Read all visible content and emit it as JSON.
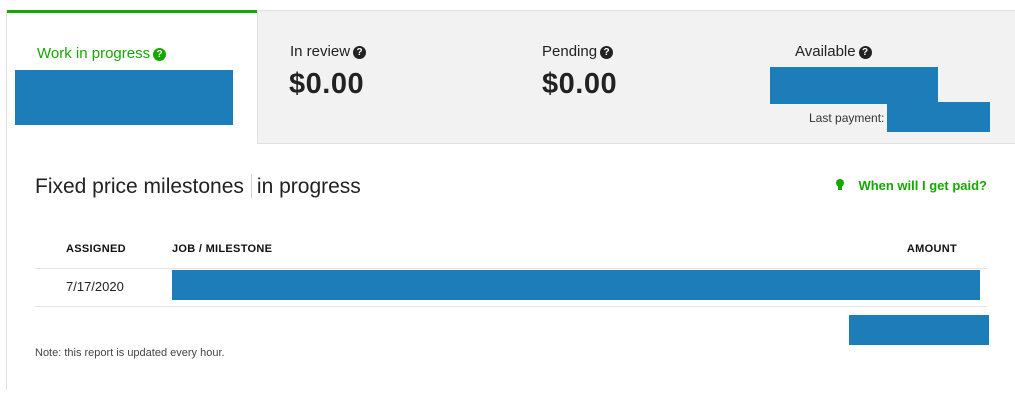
{
  "tabs": {
    "work_in_progress": {
      "label": "Work in progress"
    },
    "in_review": {
      "label": "In review",
      "amount": "$0.00"
    },
    "pending": {
      "label": "Pending",
      "amount": "$0.00"
    },
    "available": {
      "label": "Available",
      "last_payment_label": "Last payment:"
    }
  },
  "section": {
    "title": "Fixed price milestones",
    "subtitle": "in progress",
    "help_link": "When will I get paid?"
  },
  "table": {
    "columns": [
      "ASSIGNED",
      "JOB / MILESTONE",
      "AMOUNT"
    ],
    "rows": [
      {
        "assigned": "7/17/2020"
      }
    ]
  },
  "note": "Note: this report is updated every hour.",
  "colors": {
    "accent": "#14a800",
    "redaction": "#1c7db8"
  },
  "icons": {
    "help": "question-circle-icon",
    "tip": "lightbulb-icon"
  }
}
